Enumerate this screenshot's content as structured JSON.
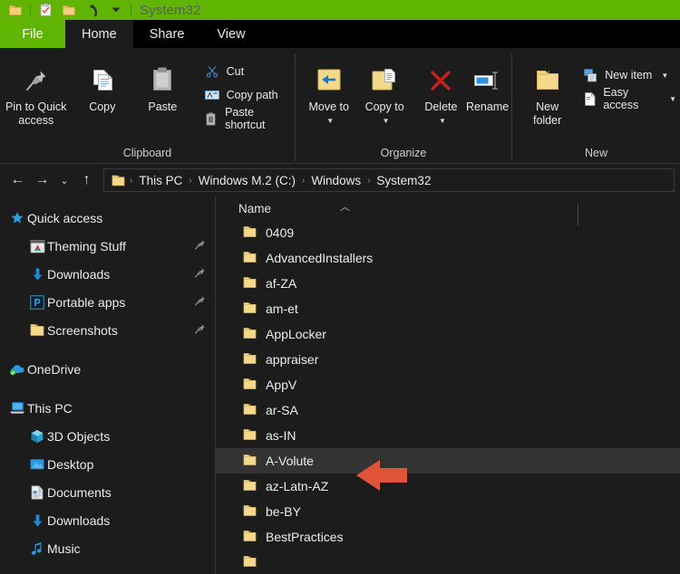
{
  "window": {
    "title": "System32",
    "quick_access_toolbar": [
      {
        "name": "properties-icon",
        "label": "Properties"
      },
      {
        "name": "new-folder-icon",
        "label": "New folder"
      },
      {
        "name": "undo-icon",
        "label": "Undo"
      },
      {
        "name": "customize-chevron-icon",
        "label": "Customize Quick Access Toolbar"
      }
    ],
    "folder_icon_label": "Folder"
  },
  "tabs": [
    {
      "label": "File",
      "active": false,
      "kind": "file"
    },
    {
      "label": "Home",
      "active": true,
      "kind": "normal"
    },
    {
      "label": "Share",
      "active": false,
      "kind": "normal"
    },
    {
      "label": "View",
      "active": false,
      "kind": "normal"
    }
  ],
  "ribbon": {
    "groups": [
      {
        "label": "Clipboard",
        "big_buttons": [
          {
            "label": "Pin to Quick access",
            "icon": "pin-icon"
          },
          {
            "label": "Copy",
            "icon": "copy-icon"
          },
          {
            "label": "Paste",
            "icon": "paste-icon"
          }
        ],
        "small_buttons": [
          {
            "label": "Cut",
            "icon": "scissors-icon"
          },
          {
            "label": "Copy path",
            "icon": "copy-path-icon"
          },
          {
            "label": "Paste shortcut",
            "icon": "paste-shortcut-icon"
          }
        ]
      },
      {
        "label": "Organize",
        "big_buttons": [
          {
            "label": "Move to",
            "icon": "move-to-icon",
            "has_caret": true
          },
          {
            "label": "Copy to",
            "icon": "copy-to-icon",
            "has_caret": true
          },
          {
            "label": "Delete",
            "icon": "delete-icon",
            "has_caret": true
          },
          {
            "label": "Rename",
            "icon": "rename-icon",
            "has_caret": false
          }
        ],
        "small_buttons": []
      },
      {
        "label": "New",
        "big_buttons": [
          {
            "label": "New folder",
            "icon": "new-folder-icon"
          }
        ],
        "small_buttons": [
          {
            "label": "New item",
            "icon": "new-item-icon",
            "has_caret": true
          },
          {
            "label": "Easy access",
            "icon": "easy-access-icon",
            "has_caret": true
          }
        ]
      }
    ]
  },
  "addressbar": {
    "nav_buttons": [
      {
        "name": "back-button",
        "glyph": "←"
      },
      {
        "name": "forward-button",
        "glyph": "→"
      },
      {
        "name": "recent-locations-button",
        "glyph": "⌄"
      },
      {
        "name": "up-button",
        "glyph": "↑"
      }
    ],
    "breadcrumbs": [
      "This PC",
      "Windows M.2 (C:)",
      "Windows",
      "System32"
    ],
    "separator": "›"
  },
  "sidebar": {
    "sections": [
      {
        "header": {
          "label": "Quick access",
          "icon": "star-icon"
        },
        "items": [
          {
            "label": "Theming Stuff",
            "icon": "theming-folder-icon",
            "pinned": true
          },
          {
            "label": "Downloads",
            "icon": "downloads-icon",
            "pinned": true
          },
          {
            "label": "Portable apps",
            "icon": "portable-apps-icon",
            "pinned": true
          },
          {
            "label": "Screenshots",
            "icon": "folder-icon",
            "pinned": true
          }
        ]
      },
      {
        "header": {
          "label": "OneDrive",
          "icon": "onedrive-icon"
        },
        "items": []
      },
      {
        "header": {
          "label": "This PC",
          "icon": "this-pc-icon"
        },
        "items": [
          {
            "label": "3D Objects",
            "icon": "3d-objects-icon",
            "pinned": false
          },
          {
            "label": "Desktop",
            "icon": "desktop-icon",
            "pinned": false
          },
          {
            "label": "Documents",
            "icon": "documents-icon",
            "pinned": false
          },
          {
            "label": "Downloads",
            "icon": "downloads-icon",
            "pinned": false
          },
          {
            "label": "Music",
            "icon": "music-icon",
            "pinned": false
          }
        ]
      }
    ]
  },
  "filelist": {
    "column_header": "Name",
    "sort_direction": "ascending",
    "rows": [
      {
        "name": "0409",
        "selected": false
      },
      {
        "name": "AdvancedInstallers",
        "selected": false
      },
      {
        "name": "af-ZA",
        "selected": false
      },
      {
        "name": "am-et",
        "selected": false
      },
      {
        "name": "AppLocker",
        "selected": false
      },
      {
        "name": "appraiser",
        "selected": false
      },
      {
        "name": "AppV",
        "selected": false
      },
      {
        "name": "ar-SA",
        "selected": false
      },
      {
        "name": "as-IN",
        "selected": false
      },
      {
        "name": "A-Volute",
        "selected": true
      },
      {
        "name": "az-Latn-AZ",
        "selected": false
      },
      {
        "name": "be-BY",
        "selected": false
      },
      {
        "name": "BestPractices",
        "selected": false
      }
    ]
  },
  "annotation": {
    "arrow": {
      "name": "annotation-arrow-left",
      "direction": "left",
      "color": "#e0553a",
      "points_to": "A-Volute"
    }
  },
  "colors": {
    "titlebar_green": "#5fb502",
    "window_background": "#1c1c1c",
    "tabstrip_black": "#000000",
    "selection_row": "#333333",
    "folder_yellow": "#f5d98a",
    "accent_blue": "#1e8ad6",
    "annotation_red": "#e0553a"
  }
}
